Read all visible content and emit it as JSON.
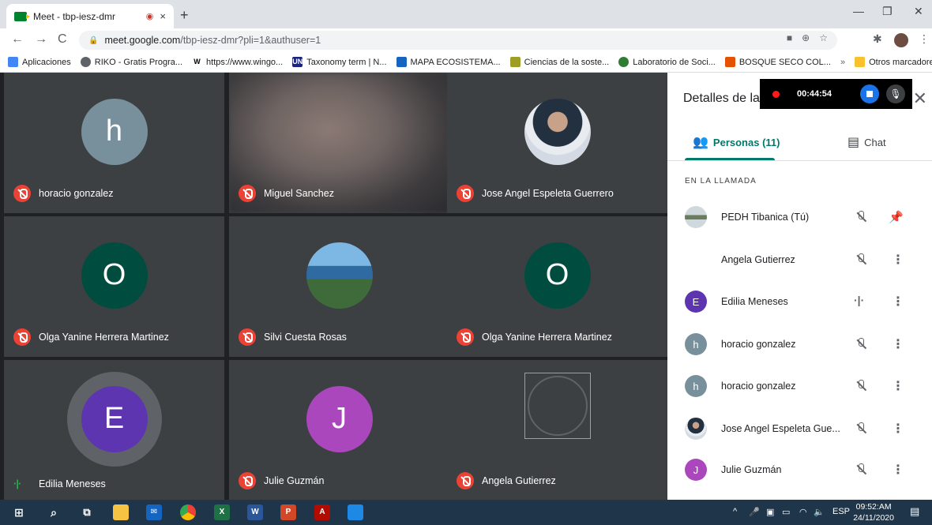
{
  "browser": {
    "tab_title": "Meet - tbp-iesz-dmr",
    "tab_recording_indicator": "◉",
    "tab_close": "×",
    "new_tab": "+",
    "url_host": "meet.google.com",
    "url_path": "/tbp-iesz-dmr?pli=1&authuser=1"
  },
  "bookmarks": [
    {
      "label": "Aplicaciones",
      "icon": "apps-grid-icon",
      "color": "#4285f4"
    },
    {
      "label": "RIKO - Gratis Progra...",
      "icon": "globe-icon",
      "color": "#5f6368"
    },
    {
      "label": "https://www.wingo...",
      "icon": "w-icon",
      "color": "#000000"
    },
    {
      "label": "Taxonomy term | N...",
      "icon": "un-icon",
      "color": "#1a237e"
    },
    {
      "label": "MAPA ECOSISTEMA...",
      "icon": "map-icon",
      "color": "#1565c0"
    },
    {
      "label": "Ciencias de la soste...",
      "icon": "book-icon",
      "color": "#9e9d24"
    },
    {
      "label": "Laboratorio de Soci...",
      "icon": "leaf-icon",
      "color": "#2e7d32"
    },
    {
      "label": "BOSQUE SECO COL...",
      "icon": "bosque-icon",
      "color": "#e65100"
    },
    {
      "label": "»",
      "icon": "",
      "color": ""
    },
    {
      "label": "Otros marcadores",
      "icon": "folder-icon",
      "color": "#fbc02d"
    }
  ],
  "tiles": [
    {
      "name": "horacio gonzalez",
      "initial": "h",
      "color": "#78909c",
      "kind": "initial",
      "muted": true
    },
    {
      "name": "Miguel Sanchez",
      "initial": "",
      "color": "",
      "kind": "video",
      "muted": true
    },
    {
      "name": "Jose Angel Espeleta Guerrero",
      "initial": "",
      "color": "",
      "kind": "photo-man",
      "muted": true
    },
    {
      "name": "Olga Yanine Herrera Martinez",
      "initial": "O",
      "color": "#004d40",
      "kind": "initial",
      "muted": true
    },
    {
      "name": "Silvi Cuesta Rosas",
      "initial": "",
      "color": "",
      "kind": "photo-woman",
      "muted": true
    },
    {
      "name": "Olga Yanine Herrera Martinez",
      "initial": "O",
      "color": "#004d40",
      "kind": "initial",
      "muted": true
    },
    {
      "name": "Edilia Meneses",
      "initial": "E",
      "color": "#5e35b1",
      "kind": "speaking",
      "muted": false
    },
    {
      "name": "Julie Guzmán",
      "initial": "J",
      "color": "#ab47bc",
      "kind": "initial",
      "muted": true
    },
    {
      "name": "Angela Gutierrez",
      "initial": "",
      "color": "",
      "kind": "broken",
      "muted": true
    }
  ],
  "panel": {
    "title": "Detalles de la",
    "people_tab": "Personas (11)",
    "chat_tab": "Chat",
    "section": "EN LA LLAMADA"
  },
  "participants": [
    {
      "name": "PEDH Tibanica (Tú)",
      "initial": "",
      "color": "#7a8a75",
      "status": "muted",
      "action": "pin"
    },
    {
      "name": "Angela Gutierrez",
      "initial": "",
      "color": "",
      "status": "muted",
      "action": "more"
    },
    {
      "name": "Edilia Meneses",
      "initial": "E",
      "color": "#5e35b1",
      "status": "speaking",
      "action": "more"
    },
    {
      "name": "horacio gonzalez",
      "initial": "h",
      "color": "#78909c",
      "status": "muted",
      "action": "more"
    },
    {
      "name": "horacio gonzalez",
      "initial": "h",
      "color": "#78909c",
      "status": "muted",
      "action": "more"
    },
    {
      "name": "Jose Angel Espeleta Gue...",
      "initial": "",
      "color": "#2b3440",
      "status": "muted",
      "action": "more"
    },
    {
      "name": "Julie Guzmán",
      "initial": "J",
      "color": "#ab47bc",
      "status": "muted",
      "action": "more"
    }
  ],
  "recording": {
    "timer": "00:44:54"
  },
  "taskbar": {
    "language": "ESP",
    "time": "09:52:AM",
    "date": "24/11/2020"
  }
}
